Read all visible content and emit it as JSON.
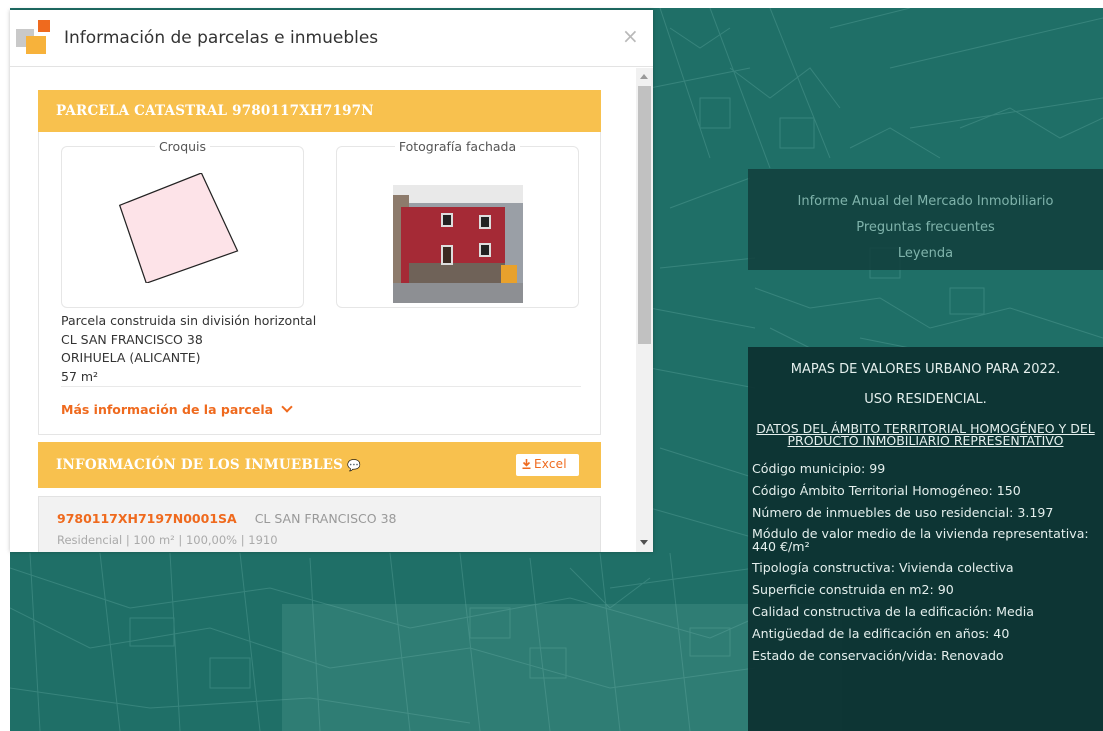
{
  "dialog": {
    "title": "Información de parcelas e inmuebles",
    "close_icon": "×"
  },
  "parcel": {
    "header": "PARCELA CATASTRAL 9780117XH7197N",
    "croquis_label": "Croquis",
    "photo_label": "Fotografía fachada",
    "info_lines": [
      "Parcela construida sin división horizontal",
      "CL SAN FRANCISCO 38",
      "ORIHUELA (ALICANTE)",
      "57 m²"
    ],
    "more_info": "Más información de la parcela"
  },
  "inmuebles": {
    "header": "INFORMACIÓN DE LOS INMUEBLES",
    "excel_label": "Excel",
    "items": [
      {
        "ref": "9780117XH7197N0001SA",
        "address": "CL SAN FRANCISCO 38",
        "meta": "Residencial | 100 m² | 100,00% | 1910"
      }
    ]
  },
  "links_panel": {
    "items": [
      "Informe Anual del Mercado Inmobiliario",
      "Preguntas frecuentes",
      "Leyenda"
    ]
  },
  "values_panel": {
    "title_line1": "MAPAS DE VALORES URBANO PARA 2022.",
    "title_line2": "USO RESIDENCIAL.",
    "subtitle": "DATOS DEL ÁMBITO TERRITORIAL HOMOGÉNEO Y DEL PRODUCTO INMOBILIARIO REPRESENTATIVO",
    "rows": [
      "Código municipio: 99",
      "Código Ámbito Territorial Homogéneo: 150",
      "Número de inmuebles de uso residencial: 3.197",
      "Módulo de valor medio de la vivienda representativa: 440 €/m²",
      "Tipología constructiva: Vivienda colectiva",
      "Superficie construida en m2: 90",
      "Calidad constructiva de la edificación: Media",
      "Antigüedad de la edificación en años: 40",
      "Estado de conservación/vida: Renovado"
    ]
  },
  "colors": {
    "accent_orange": "#ef6a1e",
    "header_yellow": "#f8c14e",
    "map_teal": "#1f6f67"
  }
}
